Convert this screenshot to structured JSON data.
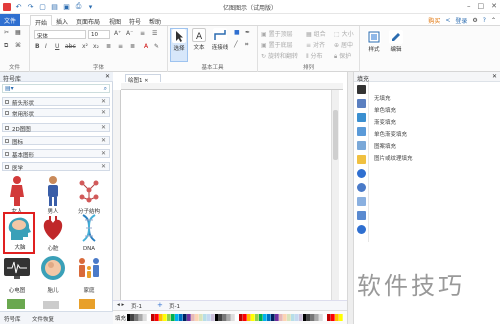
{
  "titlebar": {
    "title": "亿图图示（试用版）",
    "signup": "购买",
    "login": "登录"
  },
  "ribbon_tabs": [
    {
      "label": "文件"
    },
    {
      "label": "开始"
    },
    {
      "label": "插入"
    },
    {
      "label": "页面布局"
    },
    {
      "label": "视图"
    },
    {
      "label": "符号"
    },
    {
      "label": "帮助"
    }
  ],
  "ribbon": {
    "file_group": "文件",
    "font_group": "字体",
    "font_name": "宋体",
    "font_size": "10",
    "basic_tools_group": "基本工具",
    "arrange_group": "排列",
    "select": "选择",
    "text": "文本",
    "connector": "连接线",
    "front": "置于顶层",
    "back": "置于底层",
    "rotate_flip": "旋转和翻转",
    "group": "组合",
    "align": "对齐",
    "distribute": "分布",
    "size": "大小",
    "center": "居中",
    "protect": "保护",
    "style": "样式",
    "edit": "编辑"
  },
  "sidebar": {
    "title": "符号库",
    "categories": [
      "箭头形状",
      "常用形状",
      "2D图图",
      "图标",
      "基本图形",
      "医学"
    ],
    "symbols": [
      {
        "label": "女人",
        "icon": "woman-figure"
      },
      {
        "label": "男人",
        "icon": "man-figure"
      },
      {
        "label": "分子结构",
        "icon": "molecule"
      },
      {
        "label": "大脑",
        "icon": "head-brain"
      },
      {
        "label": "心脏",
        "icon": "heart"
      },
      {
        "label": "DNA",
        "icon": "dna"
      },
      {
        "label": "心电图",
        "icon": "ecg-monitor"
      },
      {
        "label": "胎儿",
        "icon": "fetus"
      },
      {
        "label": "家庭",
        "icon": "family"
      }
    ],
    "bottom_tabs": [
      "符号库",
      "文件恢复"
    ]
  },
  "canvas": {
    "doc_tab": "绘图1",
    "page_tab": "页-1",
    "page_name": "页-1",
    "fill_label": "填充"
  },
  "fill_panel": {
    "title": "填充",
    "options": [
      "无填充",
      "单色填充",
      "渐变填充",
      "单色渐变填充",
      "图案填充",
      "图片或纹理填充"
    ]
  },
  "watermark": "软件技巧",
  "colors": {
    "accent": "#2f6fd0",
    "selected_border": "#e02020",
    "head_teal": "#3aa0b8"
  }
}
